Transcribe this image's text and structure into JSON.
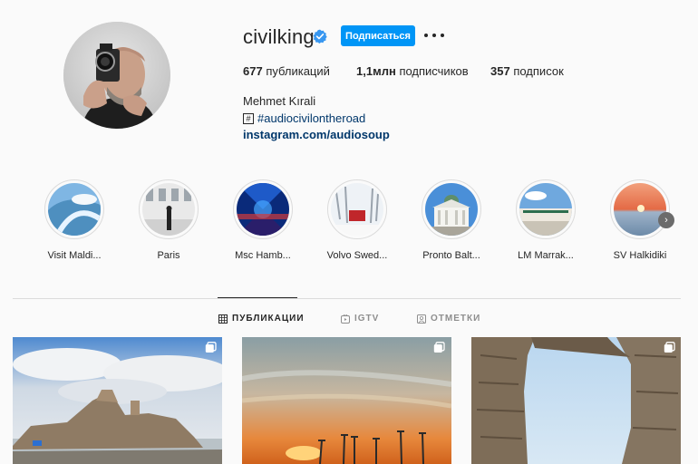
{
  "profile": {
    "username": "civilking",
    "follow_label": "Подписаться",
    "stats": {
      "posts_count": "677",
      "posts_label": "публикаций",
      "followers_count": "1,1млн",
      "followers_label": "подписчиков",
      "following_count": "357",
      "following_label": "подписок"
    },
    "full_name": "Mehmet Kırali",
    "hashtag": "#audiocivilontheroad",
    "link": "instagram.com/audiosoup"
  },
  "highlights": [
    {
      "label": "Visit Maldi..."
    },
    {
      "label": "Paris"
    },
    {
      "label": "Msc Hamb..."
    },
    {
      "label": "Volvo Swed..."
    },
    {
      "label": "Pronto Balt..."
    },
    {
      "label": "LM Marrak..."
    },
    {
      "label": "SV Halkidiki"
    }
  ],
  "tabs": [
    {
      "label": "ПУБЛИКАЦИИ",
      "active": true
    },
    {
      "label": "IGTV",
      "active": false
    },
    {
      "label": "ОТМЕТКИ",
      "active": false
    }
  ],
  "colors": {
    "accent": "#0095f6",
    "link": "#00376b",
    "text": "#262626",
    "muted": "#8e8e8e",
    "background": "#fafafa"
  }
}
